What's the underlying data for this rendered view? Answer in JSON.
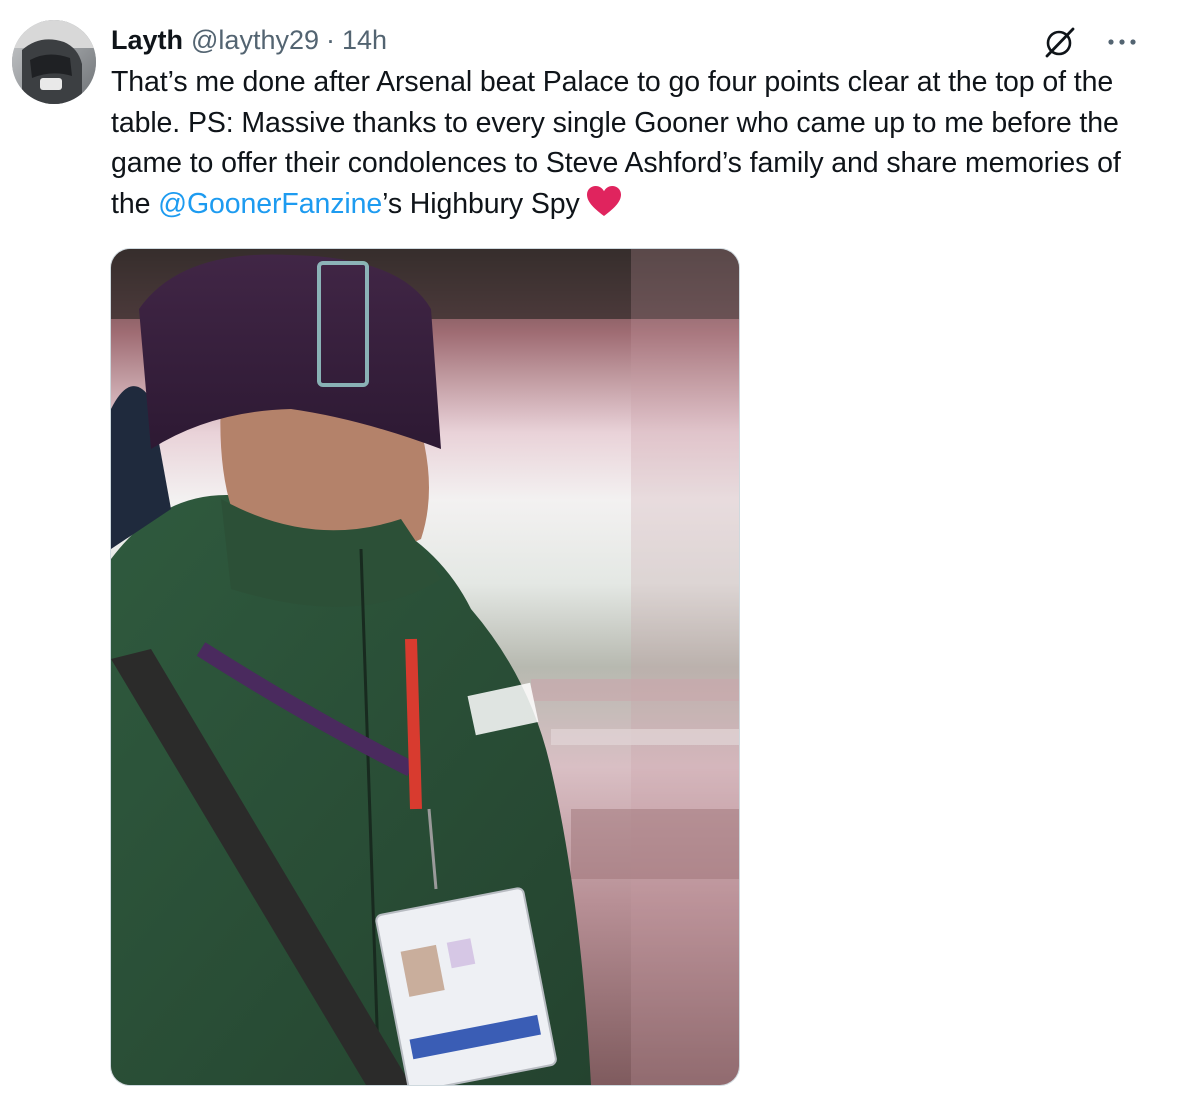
{
  "tweet": {
    "author_name": "Layth",
    "author_handle": "@laythy29",
    "separator": "·",
    "time": "14h",
    "text_part1": "That’s me done after Arsenal beat Palace to go four points clear at the top of the table. PS: Massive thanks to every single Gooner who came up to me before the game to offer their condolences to Steve Ashford’s family and share memories of the ",
    "mention": "@GoonerFanzine",
    "text_part2": "’s Highbury Spy",
    "emoji": "red-heart",
    "icons": {
      "grok": "grok-icon",
      "more": "more-options-icon"
    },
    "colors": {
      "link": "#1d9bf0",
      "secondary_text": "#536471",
      "heart": "#e0245e"
    }
  }
}
